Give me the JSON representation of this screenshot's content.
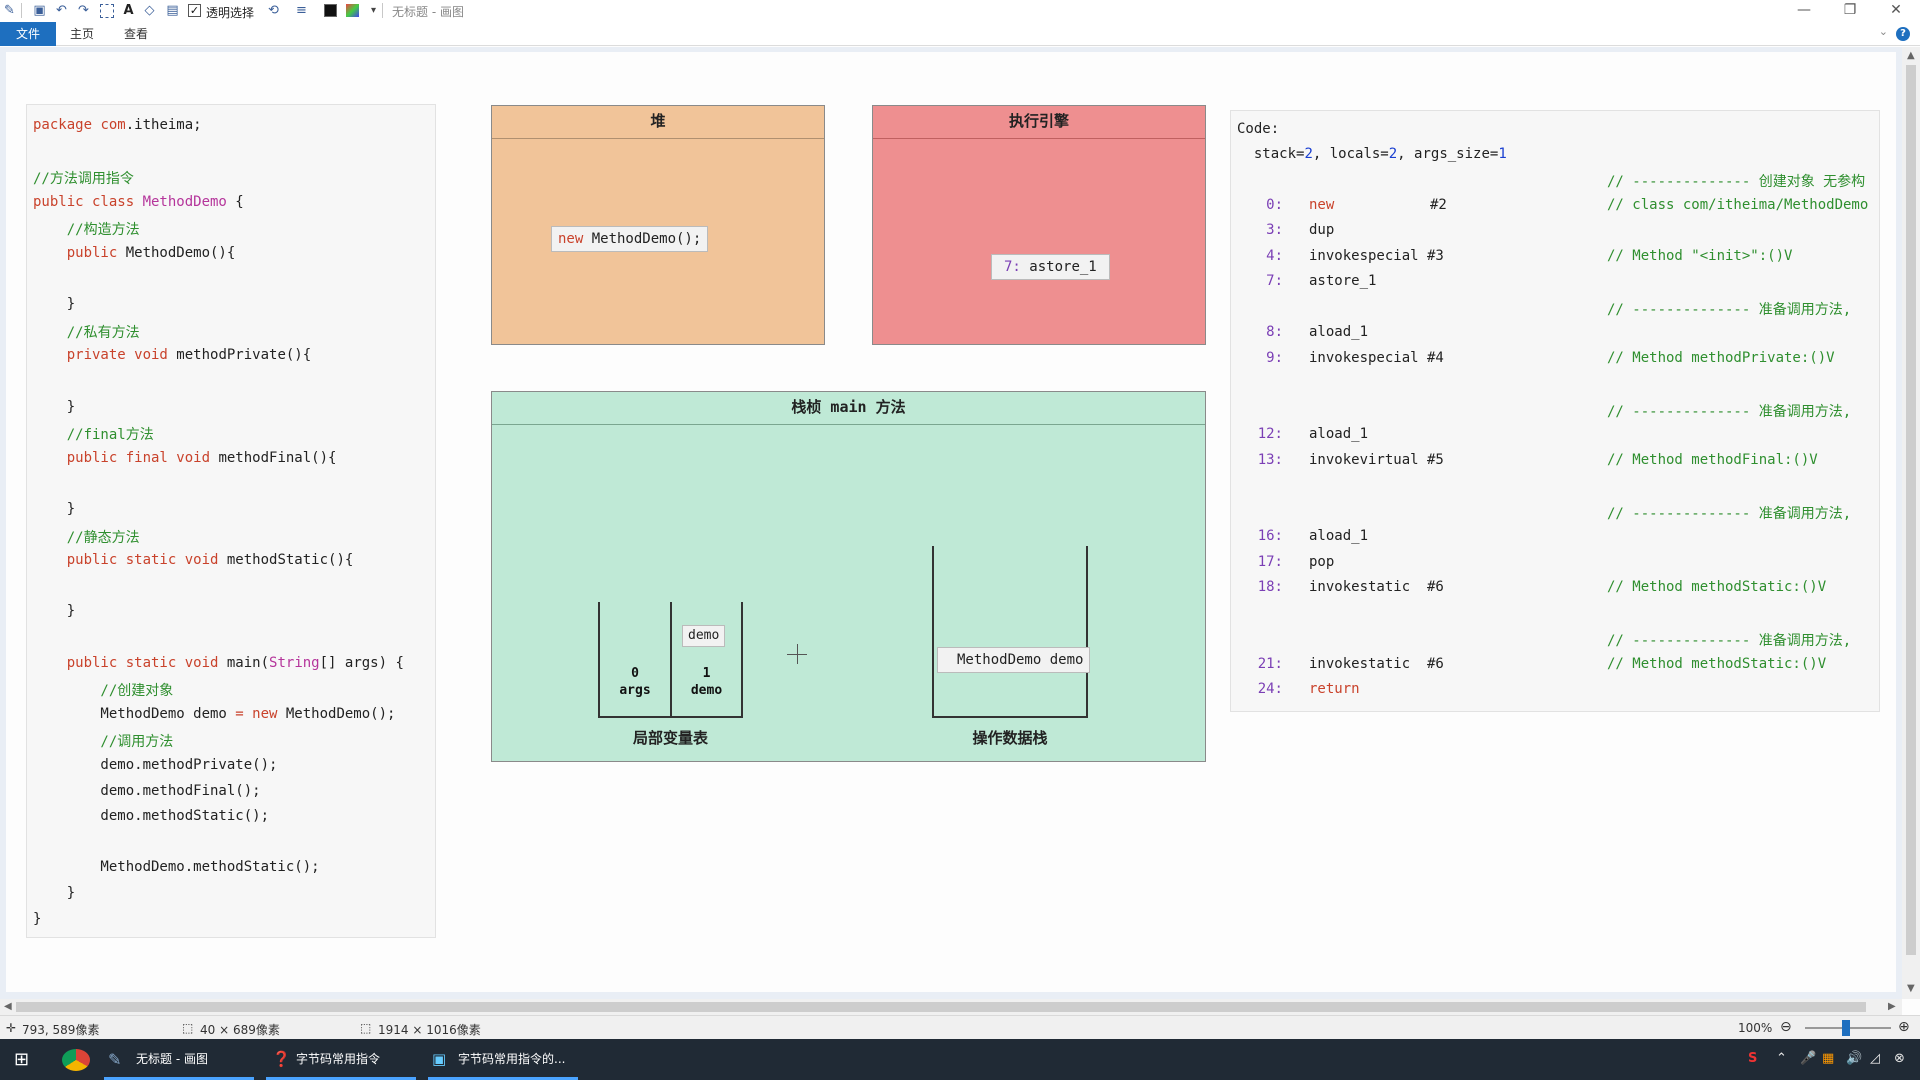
{
  "window": {
    "title": "无标题 - 画图",
    "transparent_select_label": "透明选择",
    "minimize": "—",
    "restore": "❐",
    "close": "✕"
  },
  "ribbon": {
    "tabs": [
      "文件",
      "主页",
      "查看"
    ],
    "help": "?",
    "collapse": "⌄"
  },
  "code": {
    "lines": [
      [
        {
          "t": "package ",
          "c": "kw"
        },
        {
          "t": "com",
          "c": "kw"
        },
        {
          "t": ".itheima;",
          "c": ""
        }
      ],
      [],
      [
        {
          "t": "//方法调用指令",
          "c": "cm"
        }
      ],
      [
        {
          "t": "public class ",
          "c": "kw"
        },
        {
          "t": "MethodDemo",
          "c": "ty"
        },
        {
          "t": " {",
          "c": ""
        }
      ],
      [
        {
          "t": "    //构造方法",
          "c": "cm"
        }
      ],
      [
        {
          "t": "    public ",
          "c": "kw"
        },
        {
          "t": "MethodDemo(){",
          "c": ""
        }
      ],
      [],
      [
        {
          "t": "    }",
          "c": ""
        }
      ],
      [
        {
          "t": "    //私有方法",
          "c": "cm"
        }
      ],
      [
        {
          "t": "    private void ",
          "c": "kw"
        },
        {
          "t": "methodPrivate(){",
          "c": ""
        }
      ],
      [],
      [
        {
          "t": "    }",
          "c": ""
        }
      ],
      [
        {
          "t": "    //final方法",
          "c": "cm"
        }
      ],
      [
        {
          "t": "    public final void ",
          "c": "kw"
        },
        {
          "t": "methodFinal(){",
          "c": ""
        }
      ],
      [],
      [
        {
          "t": "    }",
          "c": ""
        }
      ],
      [
        {
          "t": "    //静态方法",
          "c": "cm"
        }
      ],
      [
        {
          "t": "    public static void ",
          "c": "kw"
        },
        {
          "t": "methodStatic(){",
          "c": ""
        }
      ],
      [],
      [
        {
          "t": "    }",
          "c": ""
        }
      ],
      [],
      [
        {
          "t": "    public static void ",
          "c": "kw"
        },
        {
          "t": "main(",
          "c": ""
        },
        {
          "t": "String",
          "c": "ty"
        },
        {
          "t": "[] args) {",
          "c": ""
        }
      ],
      [
        {
          "t": "        //创建对象",
          "c": "cm"
        }
      ],
      [
        {
          "t": "        MethodDemo demo ",
          "c": ""
        },
        {
          "t": "= new ",
          "c": "kw"
        },
        {
          "t": "MethodDemo();",
          "c": ""
        }
      ],
      [
        {
          "t": "        //调用方法",
          "c": "cm"
        }
      ],
      [
        {
          "t": "        demo.methodPrivate();",
          "c": ""
        }
      ],
      [
        {
          "t": "        demo.methodFinal();",
          "c": ""
        }
      ],
      [
        {
          "t": "        demo.methodStatic();",
          "c": ""
        }
      ],
      [],
      [
        {
          "t": "        MethodDemo.methodStatic();",
          "c": ""
        }
      ],
      [
        {
          "t": "    }",
          "c": ""
        }
      ],
      [
        {
          "t": "}",
          "c": ""
        }
      ]
    ]
  },
  "heap": {
    "title": "堆",
    "chip_kw": "new ",
    "chip_rest": "MethodDemo();"
  },
  "exec_engine": {
    "title": "执行引擎",
    "chip_num": "7: ",
    "chip_rest": "astore_1"
  },
  "frame": {
    "title": "栈桢 main 方法",
    "slot0_index": "0",
    "slot0_name": "args",
    "slot1_index": "1",
    "slot1_name": "demo",
    "slot1_chip": "demo",
    "locals_label": "局部变量表",
    "operand_label": "操作数据栈",
    "operand_chip": "MethodDemo demo"
  },
  "bytecode": {
    "header": "Code:",
    "stack_line": [
      {
        "t": "  stack=",
        "c": ""
      },
      {
        "t": "2",
        "c": "num"
      },
      {
        "t": ", locals=",
        "c": ""
      },
      {
        "t": "2",
        "c": "num"
      },
      {
        "t": ", args_size=",
        "c": ""
      },
      {
        "t": "1",
        "c": "num"
      }
    ],
    "rows": [
      {
        "idx": "",
        "op": "",
        "arg": "",
        "cm": "// -------------- 创建对象 无参构"
      },
      {
        "idx": "0:",
        "op": "new",
        "op_kw": true,
        "arg": "#2",
        "cm": "// class com/itheima/MethodDemo"
      },
      {
        "idx": "3:",
        "op": "dup",
        "arg": "",
        "cm": ""
      },
      {
        "idx": "4:",
        "op": "invokespecial #3",
        "arg": "",
        "cm": "// Method \"<init>\":()V"
      },
      {
        "idx": "7:",
        "op": "astore_1",
        "arg": "",
        "cm": ""
      },
      {
        "idx": "",
        "op": "",
        "arg": "",
        "cm": "// -------------- 准备调用方法,"
      },
      {
        "idx": "8:",
        "op": "aload_1",
        "arg": "",
        "cm": ""
      },
      {
        "idx": "9:",
        "op": "invokespecial #4",
        "arg": "",
        "cm": "// Method methodPrivate:()V"
      },
      {
        "idx": "",
        "op": "",
        "arg": "",
        "cm": ""
      },
      {
        "idx": "",
        "op": "",
        "arg": "",
        "cm": "// -------------- 准备调用方法,"
      },
      {
        "idx": "12:",
        "op": "aload_1",
        "arg": "",
        "cm": ""
      },
      {
        "idx": "13:",
        "op": "invokevirtual #5",
        "arg": "",
        "cm": "// Method methodFinal:()V"
      },
      {
        "idx": "",
        "op": "",
        "arg": "",
        "cm": ""
      },
      {
        "idx": "",
        "op": "",
        "arg": "",
        "cm": "// -------------- 准备调用方法,"
      },
      {
        "idx": "16:",
        "op": "aload_1",
        "arg": "",
        "cm": ""
      },
      {
        "idx": "17:",
        "op": "pop",
        "arg": "",
        "cm": ""
      },
      {
        "idx": "18:",
        "op": "invokestatic  #6",
        "arg": "",
        "cm": "// Method methodStatic:()V"
      },
      {
        "idx": "",
        "op": "",
        "arg": "",
        "cm": ""
      },
      {
        "idx": "",
        "op": "",
        "arg": "",
        "cm": "// -------------- 准备调用方法,"
      },
      {
        "idx": "21:",
        "op": "invokestatic  #6",
        "arg": "",
        "cm": "// Method methodStatic:()V"
      },
      {
        "idx": "24:",
        "op": "return",
        "op_kw": true,
        "arg": "",
        "cm": ""
      }
    ]
  },
  "statusbar": {
    "cursor_pos": "793, 589像素",
    "selection_size": "40 × 689像素",
    "image_size": "1914 × 1016像素",
    "zoom": "100%"
  },
  "taskbar": {
    "items": [
      "无标题 - 画图",
      "字节码常用指令",
      "字节码常用指令的..."
    ]
  },
  "colors": {
    "keyword": "#c9422b",
    "comment": "#2f8f2f",
    "type": "#b5359b",
    "number": "#1a3fd1",
    "index": "#7b3fb5",
    "accent": "#1e6fbf"
  }
}
